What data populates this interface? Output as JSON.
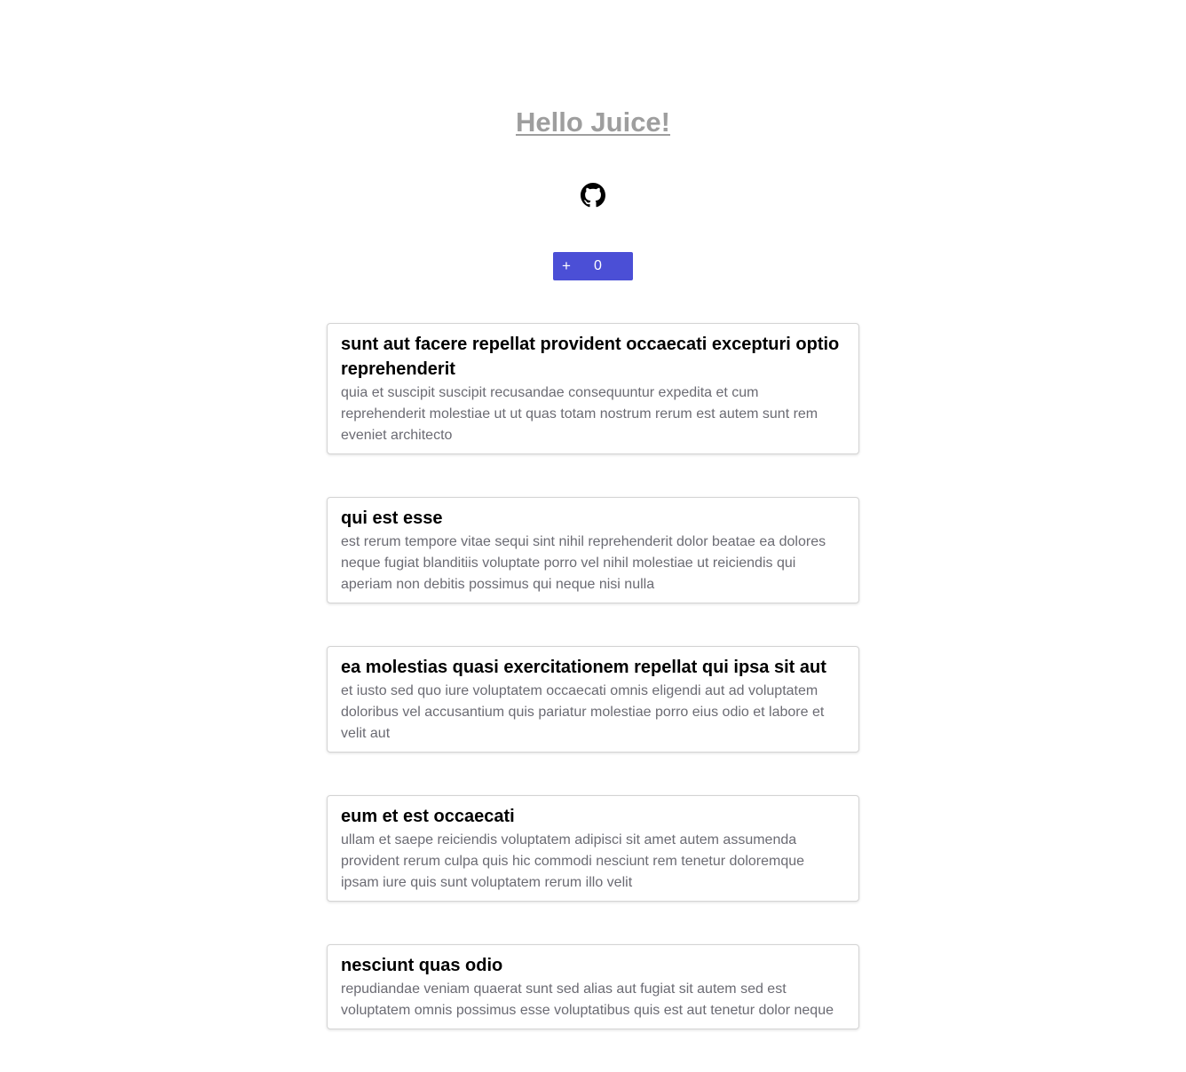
{
  "header": {
    "title": "Hello Juice!",
    "github_icon": "github-icon"
  },
  "counter": {
    "plus_label": "+",
    "value": "0",
    "color": "#4b4fd6"
  },
  "posts": [
    {
      "title": "sunt aut facere repellat provident occaecati excepturi optio reprehenderit",
      "body": "quia et suscipit suscipit recusandae consequuntur expedita et cum reprehenderit molestiae ut ut quas totam nostrum rerum est autem sunt rem eveniet architecto"
    },
    {
      "title": "qui est esse",
      "body": "est rerum tempore vitae sequi sint nihil reprehenderit dolor beatae ea dolores neque fugiat blanditiis voluptate porro vel nihil molestiae ut reiciendis qui aperiam non debitis possimus qui neque nisi nulla"
    },
    {
      "title": "ea molestias quasi exercitationem repellat qui ipsa sit aut",
      "body": "et iusto sed quo iure voluptatem occaecati omnis eligendi aut ad voluptatem doloribus vel accusantium quis pariatur molestiae porro eius odio et labore et velit aut"
    },
    {
      "title": "eum et est occaecati",
      "body": "ullam et saepe reiciendis voluptatem adipisci sit amet autem assumenda provident rerum culpa quis hic commodi nesciunt rem tenetur doloremque ipsam iure quis sunt voluptatem rerum illo velit"
    },
    {
      "title": "nesciunt quas odio",
      "body": "repudiandae veniam quaerat sunt sed alias aut fugiat sit autem sed est voluptatem omnis possimus esse voluptatibus quis est aut tenetur dolor neque"
    }
  ]
}
